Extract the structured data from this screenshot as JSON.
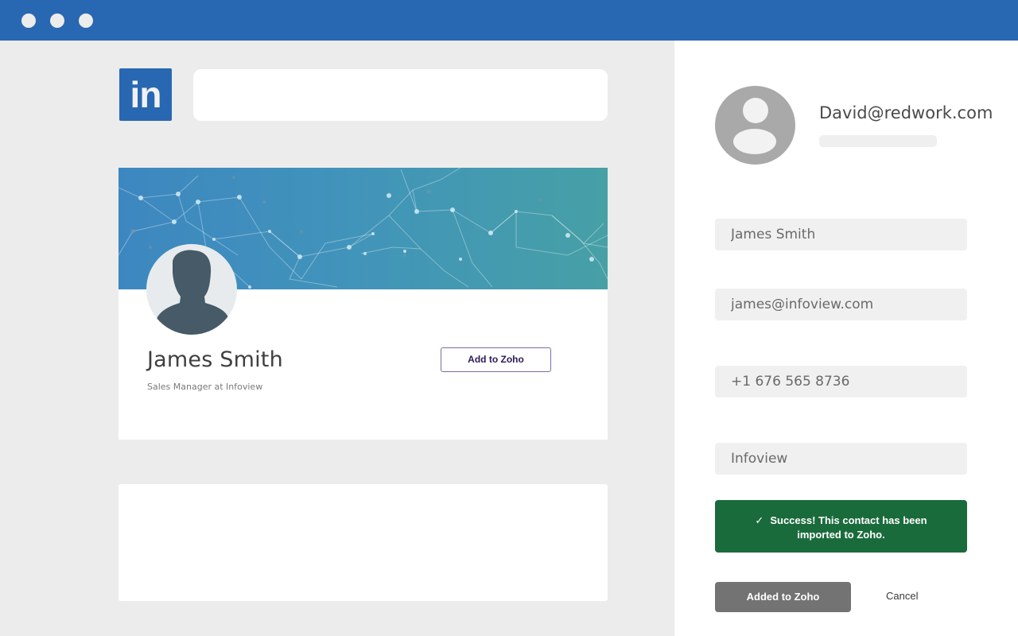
{
  "window": {
    "controls": [
      "close",
      "minimize",
      "maximize"
    ],
    "titlebar_color": "#2867b2"
  },
  "linkedin": {
    "logo_text": "in",
    "brand_color": "#2867b2",
    "search": {
      "value": "",
      "placeholder": ""
    },
    "profile": {
      "name": "James Smith",
      "title": "Sales Manager at Infoview",
      "add_button_label": "Add to Zoho",
      "avatar_icon": "person-silhouette-icon"
    }
  },
  "zoho_panel": {
    "user_email": "David@redwork.com",
    "avatar_icon": "user-icon",
    "fields": [
      {
        "name": "name",
        "value": "James Smith"
      },
      {
        "name": "email",
        "value": "james@infoview.com"
      },
      {
        "name": "phone",
        "value": "+1 676 565 8736"
      },
      {
        "name": "company",
        "value": "Infoview"
      }
    ],
    "success": {
      "icon": "check-icon",
      "line1": "Success! This contact has been",
      "line2": "imported to Zoho.",
      "color": "#1a6b3c"
    },
    "added_button_label": "Added to Zoho",
    "cancel_label": "Cancel"
  }
}
